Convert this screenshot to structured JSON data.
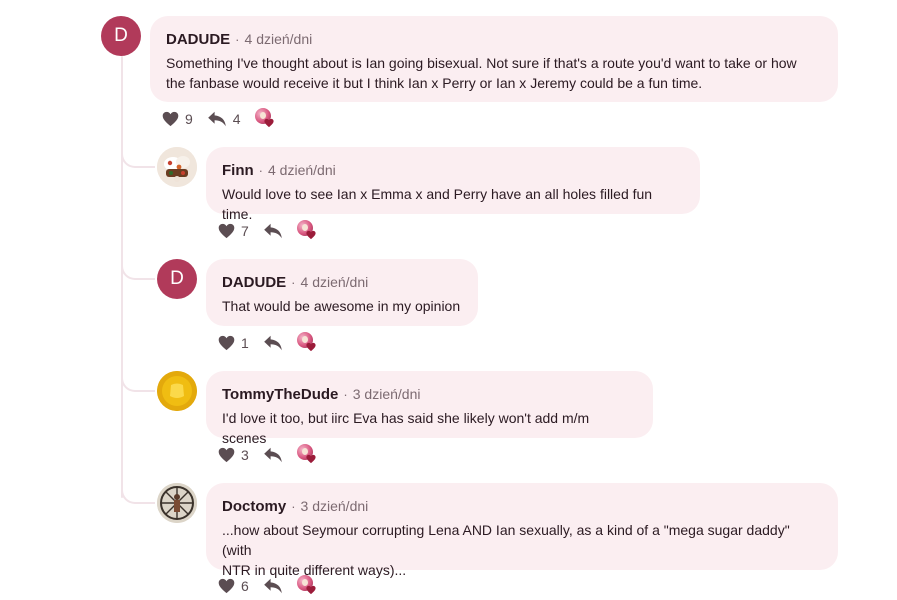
{
  "comments": [
    {
      "avatar_letter": "D",
      "author": "DADUDE",
      "separator": "·",
      "time": "4 dzień/dni",
      "lines": [
        "Something I've thought about is Ian going bisexual. Not sure if that's a route you'd want to take or how",
        "the fanbase would receive it but I think Ian x Perry or Ian x Jeremy could be a fun time."
      ],
      "likes": "9",
      "replies": "4"
    },
    {
      "author": "Finn",
      "separator": "·",
      "time": "4 dzień/dni",
      "lines": [
        "Would love to see Ian x Emma x and Perry have an all holes filled fun time."
      ],
      "likes": "7"
    },
    {
      "avatar_letter": "D",
      "author": "DADUDE",
      "separator": "·",
      "time": "4 dzień/dni",
      "lines": [
        "That would be awesome in my opinion"
      ],
      "likes": "1"
    },
    {
      "author": "TommyTheDude",
      "separator": "·",
      "time": "3 dzień/dni",
      "lines": [
        "I'd love it too, but iirc Eva has said she likely won't add m/m scenes"
      ],
      "likes": "3"
    },
    {
      "author": "Doctomy",
      "separator": "·",
      "time": "3 dzień/dni",
      "lines": [
        "...how about Seymour corrupting Lena AND Ian sexually, as a kind of a \"mega sugar daddy\" (with",
        "NTR in quite different ways)..."
      ],
      "likes": "6"
    }
  ],
  "colors": {
    "avatar_letter_bg": "#b13a5a",
    "bubble_bg": "#fbeef1",
    "thread_line": "#f1e3e8"
  },
  "icons": [
    "heart-icon",
    "reply-icon",
    "reaction-icon"
  ]
}
